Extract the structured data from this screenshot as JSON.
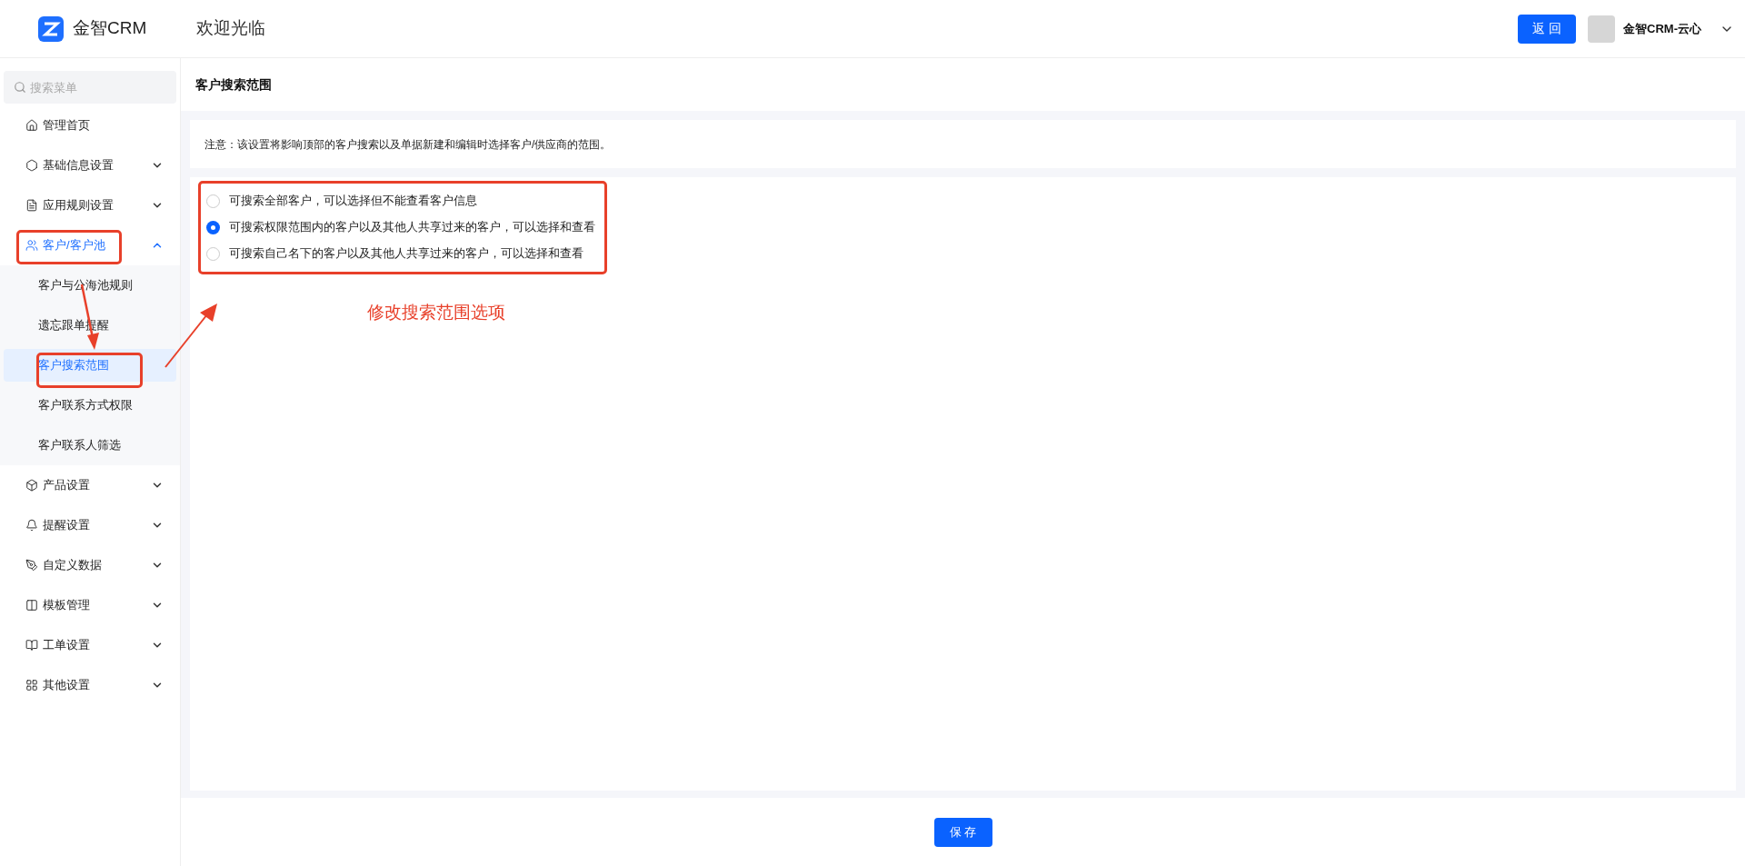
{
  "header": {
    "logo_text": "金智CRM",
    "welcome": "欢迎光临",
    "back_button": "返 回",
    "user_name": "金智CRM-云心"
  },
  "sidebar": {
    "search": {
      "placeholder": "搜索菜单"
    },
    "items": [
      {
        "label": "管理首页",
        "selected": false
      },
      {
        "label": "基础信息设置",
        "selected": false,
        "expanded": false
      },
      {
        "label": "应用规则设置",
        "selected": false,
        "expanded": false
      },
      {
        "label": "客户/客户池",
        "selected": true,
        "expanded": true,
        "children": [
          {
            "label": "客户与公海池规则",
            "selected": false
          },
          {
            "label": "遗忘跟单提醒",
            "selected": false
          },
          {
            "label": "客户搜索范围",
            "selected": true
          },
          {
            "label": "客户联系方式权限",
            "selected": false
          },
          {
            "label": "客户联系人筛选",
            "selected": false
          }
        ]
      },
      {
        "label": "产品设置",
        "selected": false,
        "expanded": false
      },
      {
        "label": "提醒设置",
        "selected": false,
        "expanded": false
      },
      {
        "label": "自定义数据",
        "selected": false,
        "expanded": false
      },
      {
        "label": "模板管理",
        "selected": false,
        "expanded": false
      },
      {
        "label": "工单设置",
        "selected": false,
        "expanded": false
      },
      {
        "label": "其他设置",
        "selected": false,
        "expanded": false
      }
    ]
  },
  "page": {
    "title": "客户搜索范围",
    "notice": "注意：该设置将影响顶部的客户搜索以及单据新建和编辑时选择客户/供应商的范围。",
    "options": [
      {
        "label": "可搜索全部客户，可以选择但不能查看客户信息",
        "selected": false
      },
      {
        "label": "可搜索权限范围内的客户以及其他人共享过来的客户，可以选择和查看",
        "selected": true
      },
      {
        "label": "可搜索自己名下的客户以及其他人共享过来的客户，可以选择和查看",
        "selected": false
      }
    ],
    "save_button": "保 存"
  },
  "annotation": {
    "note": "修改搜索范围选项"
  }
}
